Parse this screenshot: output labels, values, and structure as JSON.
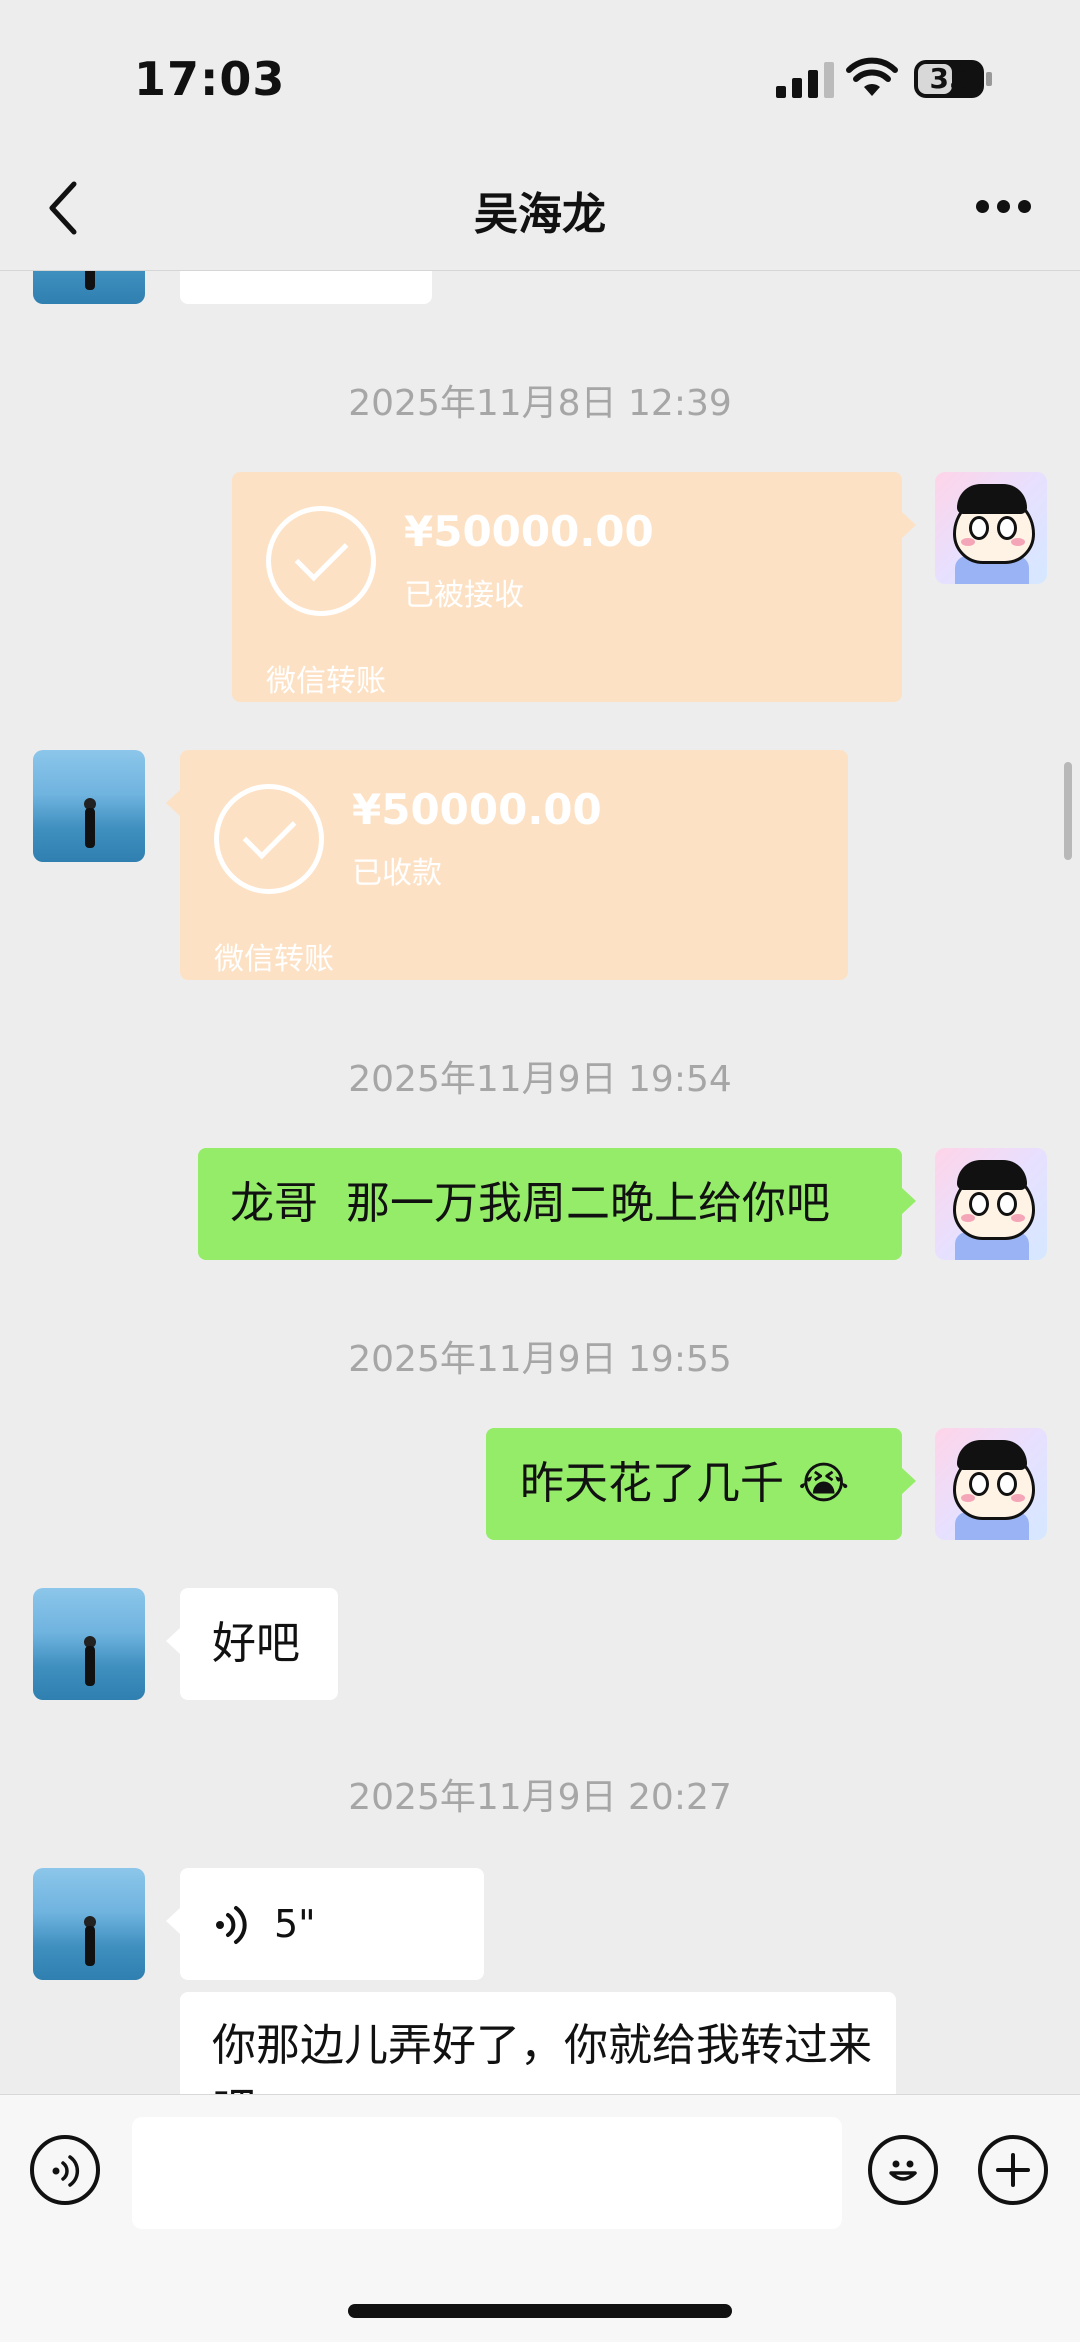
{
  "status_bar": {
    "time": "17:03",
    "battery": "35"
  },
  "header": {
    "title": "吴海龙"
  },
  "messages": {
    "ts1": "2025年11月8日 12:39",
    "transfer_sent": {
      "amount": "¥50000.00",
      "status": "已被接收",
      "label": "微信转账"
    },
    "transfer_received": {
      "amount": "¥50000.00",
      "status": "已收款",
      "label": "微信转账"
    },
    "ts2": "2025年11月9日 19:54",
    "msg1": "龙哥  那一万我周二晚上给你吧",
    "ts3": "2025年11月9日 19:55",
    "msg2": "昨天花了几千 😭",
    "msg3": "好吧",
    "ts4": "2025年11月9日 20:27",
    "voice_duration": "5\"",
    "msg4": "你那边儿弄好了，你就给我转过来吧"
  },
  "input": {
    "placeholder": ""
  },
  "colors": {
    "green_bubble": "#95ec69",
    "transfer_bubble": "#fde1c4",
    "background": "#ededed"
  },
  "icons": [
    "back-icon",
    "more-icon",
    "voice-icon",
    "emoji-icon",
    "plus-icon",
    "signal-icon",
    "wifi-icon",
    "battery-icon"
  ]
}
